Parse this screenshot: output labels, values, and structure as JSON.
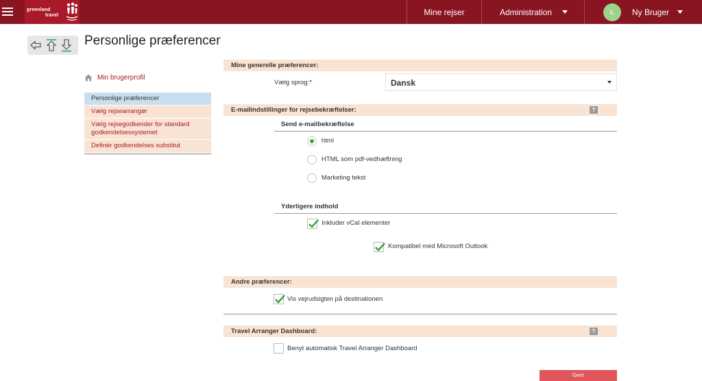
{
  "header": {
    "logo_line1": "greenland",
    "logo_line2": "travel",
    "nav_my_trips": "Mine rejser",
    "nav_administration": "Administration",
    "user_initials": "IL",
    "user_name": "Ny Bruger"
  },
  "page": {
    "title": "Personlige præferencer"
  },
  "sidebar": {
    "profile_link": "Min brugerprofil",
    "items": [
      {
        "label": "Personlige præferencer",
        "active": true
      },
      {
        "label": "Vælg rejsearrangør"
      },
      {
        "label": "Vælg rejsegodkender for standard godkendelsessystemet"
      },
      {
        "label": "Definér godkendelses substitut"
      }
    ]
  },
  "general": {
    "header": "Mine generelle præferencer:",
    "language_label": "Vælg sprog:*",
    "language_value": "Dansk"
  },
  "email": {
    "header": "E-mailindstillinger for rejsebekræftelser:",
    "help": "?",
    "send_header": "Send e-mailbekræftelse",
    "options": [
      "html",
      "HTML som pdf-vedhæftning",
      "Marketing tekst"
    ],
    "selected": "html",
    "extra_header": "Yderligere indhold",
    "include_vcal": "Inkluder vCal elementer",
    "outlook_compat": "Kompatibel med Microsoft Outlook",
    "include_vcal_checked": true,
    "outlook_compat_checked": true
  },
  "other": {
    "header": "Andre præferencer:",
    "weather": "Vis vejrudsigten på destinationen",
    "weather_checked": true
  },
  "dashboard": {
    "header": "Travel Arranger Dashboard:",
    "help": "?",
    "auto": "Benyt automatisk Travel Arranger Dashboard",
    "auto_checked": false
  },
  "actions": {
    "save": "Gem"
  },
  "colors": {
    "brand": "#8a1522",
    "section_bg": "#f9e4d4",
    "active_item": "#c9dff0",
    "link": "#a8192a",
    "check": "#3ca34a",
    "save": "#e0575b"
  }
}
